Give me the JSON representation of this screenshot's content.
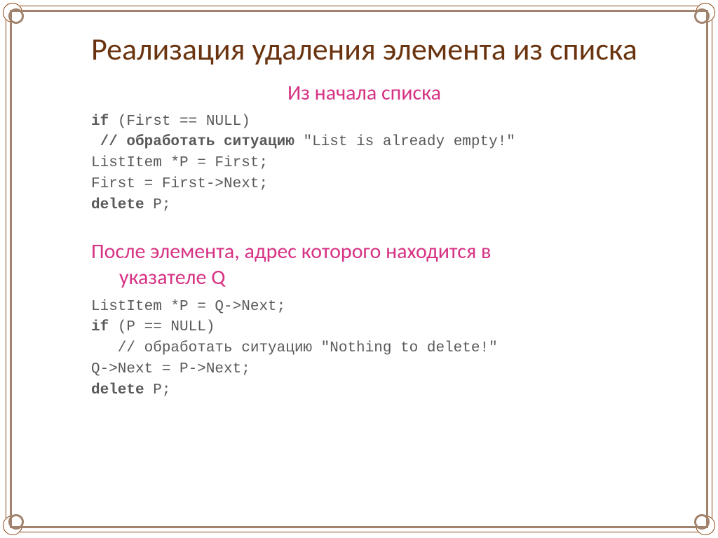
{
  "title": "Реализация удаления элемента из списка",
  "section1": {
    "heading": "Из начала списка",
    "code_lines": [
      {
        "bold": true,
        "text": "if",
        "rest": " (First == NULL)"
      },
      {
        "bold": true,
        "text": " // обработать ситуацию",
        "rest": " \"List is already empty!\""
      },
      {
        "bold": false,
        "text": "",
        "rest": "ListItem *P = First;"
      },
      {
        "bold": false,
        "text": "",
        "rest": "First = First->Next;"
      },
      {
        "bold": true,
        "text": "delete",
        "rest": " P;"
      }
    ],
    "raw": "if (First == NULL)\n // обработать ситуацию \"List is already empty!\"\nListItem *P = First;\nFirst = First->Next;\ndelete P;"
  },
  "section2": {
    "heading_line1": "После элемента, адрес которого находится в",
    "heading_line2": "указателе Q",
    "code_lines": [
      {
        "bold": false,
        "text": "",
        "rest": "ListItem *P = Q->Next;"
      },
      {
        "bold": true,
        "text": "if",
        "rest": " (P == NULL)"
      },
      {
        "bold": false,
        "text": "   // обработать ситуацию",
        "rest": " \"Nothing to delete!\""
      },
      {
        "bold": false,
        "text": "",
        "rest": "Q->Next = P->Next;"
      },
      {
        "bold": true,
        "text": "delete",
        "rest": " P;"
      }
    ],
    "raw": "ListItem *P = Q->Next;\nif (P == NULL)\n   // обработать ситуацию \"Nothing to delete!\"\nQ->Next = P->Next;\ndelete P;"
  }
}
